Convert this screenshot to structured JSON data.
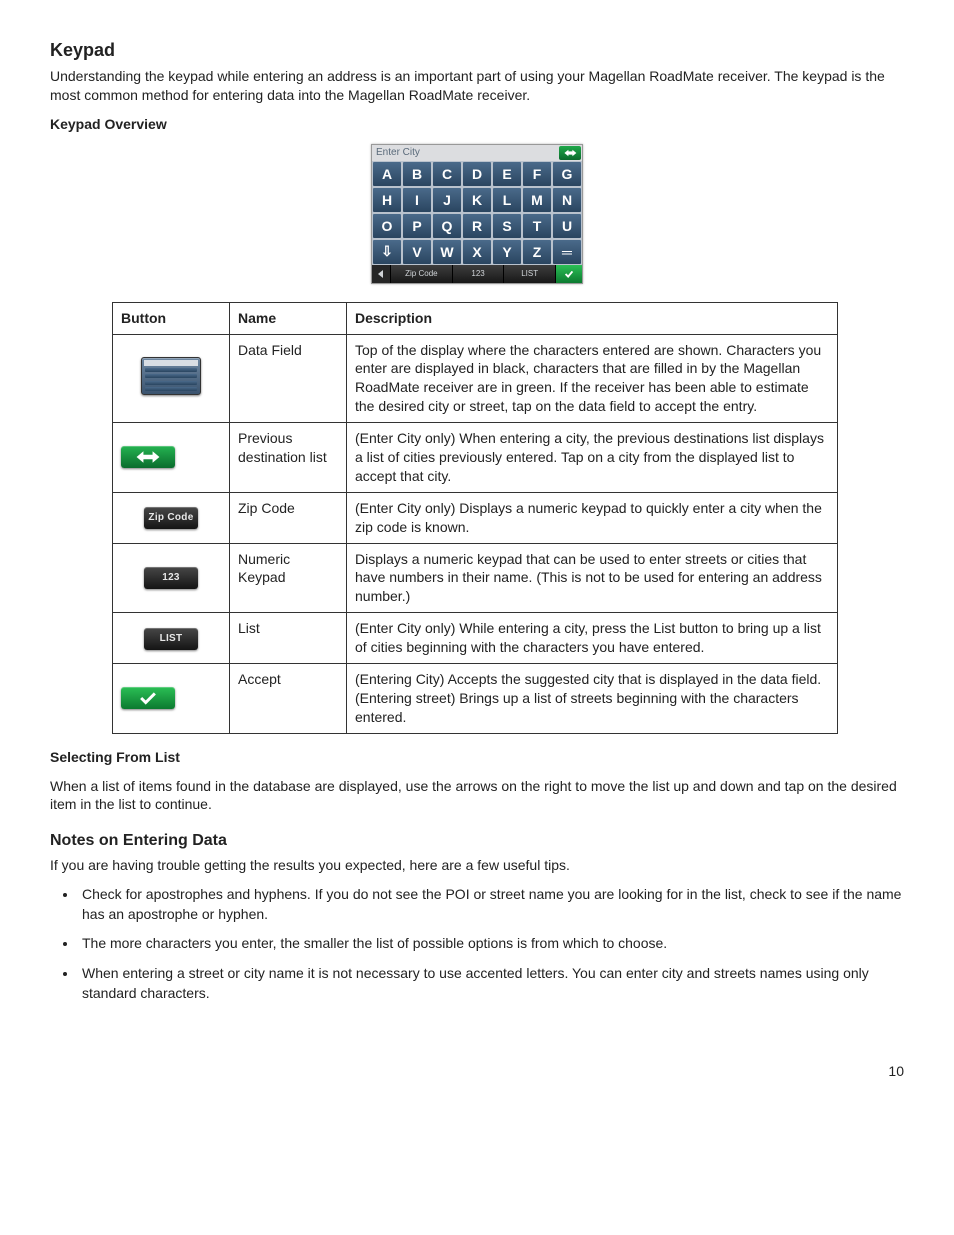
{
  "page_number": "10",
  "h_keypad": "Keypad",
  "p_intro": "Understanding the keypad while entering an address is an important part of using your Magellan RoadMate receiver. The keypad is the most common method for entering data into the Magellan RoadMate receiver.",
  "h_overview": "Keypad Overview",
  "keypad": {
    "field_label": "Enter City",
    "rows": [
      [
        "A",
        "B",
        "C",
        "D",
        "E",
        "F",
        "G"
      ],
      [
        "H",
        "I",
        "J",
        "K",
        "L",
        "M",
        "N"
      ],
      [
        "O",
        "P",
        "Q",
        "R",
        "S",
        "T",
        "U"
      ],
      [
        "⇩",
        "V",
        "W",
        "X",
        "Y",
        "Z",
        "═"
      ]
    ],
    "bottom": {
      "zip": "Zip Code",
      "num": "123",
      "list": "LIST"
    }
  },
  "table": {
    "headers": {
      "button": "Button",
      "name": "Name",
      "desc": "Description"
    },
    "rows": [
      {
        "icon": "datafield",
        "name": "Data Field",
        "desc": "Top of the display where the characters entered are shown. Characters you enter are displayed in black, characters that are filled in by the Magellan RoadMate receiver are in green.  If the receiver has been able to estimate the desired city or street, tap on the data field to accept the entry."
      },
      {
        "icon": "prev",
        "name": "Previous destination list",
        "desc": "(Enter City only)  When entering a city, the previous destinations list displays a list of cities previously entered.  Tap on a city from the displayed list to accept that city."
      },
      {
        "icon": "zip",
        "label": "Zip Code",
        "name": "Zip Code",
        "desc": "(Enter City only)  Displays a numeric keypad to quickly enter a city when the zip code is known."
      },
      {
        "icon": "num",
        "label": "123",
        "name": "Numeric Keypad",
        "desc": "Displays a numeric keypad that can be used to enter streets or cities that have numbers in their name.  (This is not to be used for entering an address number.)"
      },
      {
        "icon": "list",
        "label": "LIST",
        "name": "List",
        "desc": "(Enter City only)  While entering a city, press the List button to bring up a list of cities beginning with the characters you have entered."
      },
      {
        "icon": "accept",
        "name": "Accept",
        "desc": "(Entering City)  Accepts the suggested city that is displayed in the data field.  (Entering street) Brings up a list of streets beginning with the characters entered."
      }
    ]
  },
  "h_selecting": "Selecting From List",
  "p_selecting": "When a list of items found in the database are displayed, use the arrows on the right to move the list up and down and tap on the desired item in the list to continue.",
  "h_notes": "Notes on Entering Data",
  "p_notes_intro": "If you are having trouble getting the results you expected, here are a few useful tips.",
  "tips": [
    "Check for apostrophes and hyphens. If you do not see the POI or street name you are looking for in the list, check to see if the name has an apostrophe or hyphen.",
    "The more characters you enter, the smaller the list of possible options is from which to choose.",
    "When entering a street or city name it is not necessary to use accented letters. You can enter city and streets names using only standard characters."
  ]
}
